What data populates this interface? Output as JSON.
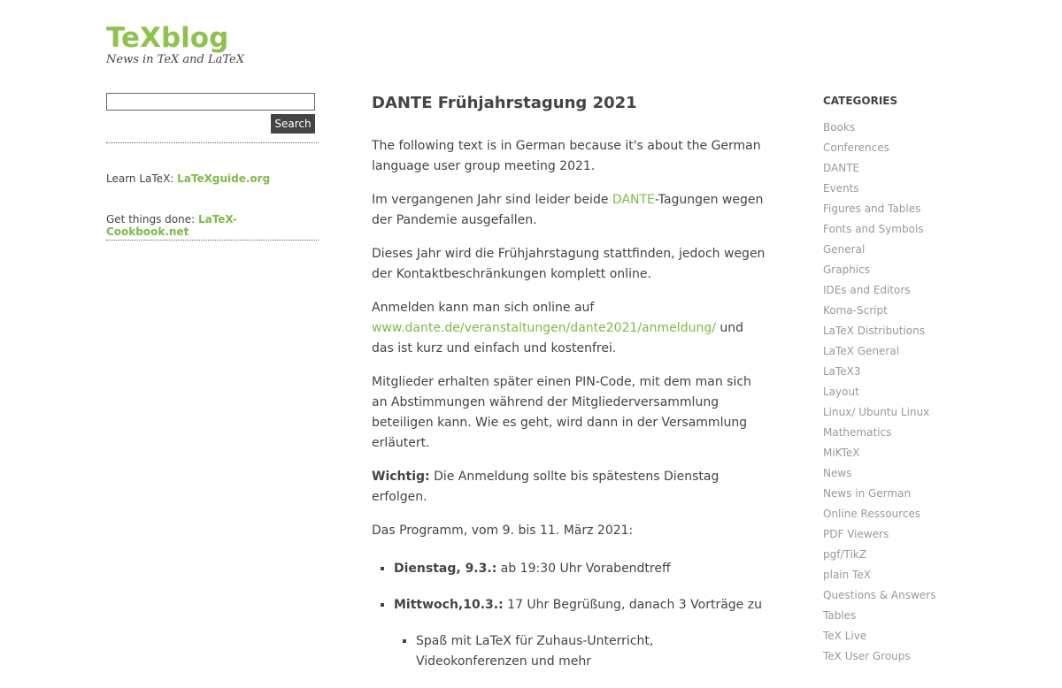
{
  "header": {
    "site_title": "TeXblog",
    "tagline": "News in TeX and LaTeX"
  },
  "search": {
    "button_label": "Search",
    "value": ""
  },
  "left_widgets": [
    {
      "prefix": "Learn LaTeX:",
      "link": "LaTeXguide.org"
    },
    {
      "prefix": "Get things done:",
      "link": "LaTeX-Cookbook.net"
    }
  ],
  "post": {
    "title": "DANTE Frühjahrstagung 2021",
    "p1": "The following text is in German because it's about the German language user group meeting 2021.",
    "p2_before": "Im vergangenen Jahr sind leider beide ",
    "p2_link": "DANTE",
    "p2_after": "-Tagungen wegen der Pandemie ausgefallen.",
    "p3": "Dieses Jahr wird die Frühjahrstagung stattfinden, jedoch wegen der Kontaktbeschränkungen komplett online.",
    "p4_before": "Anmelden kann man sich online auf ",
    "p4_link": "www.dante.de/veranstaltungen/dante2021/anmeldung/",
    "p4_after": " und das ist kurz und einfach und kostenfrei.",
    "p5": "Mitglieder erhalten später einen PIN-Code, mit dem man sich an Abstimmungen während der Mitgliederversammlung beteiligen kann. Wie es geht, wird dann in der Versammlung erläutert.",
    "p6_bold": "Wichtig:",
    "p6_text": " Die Anmeldung sollte bis spätestens Dienstag erfolgen.",
    "p7": "Das Programm, vom 9. bis 11. März 2021:",
    "program": [
      {
        "bold": "Dienstag, 9.3.:",
        "text": " ab 19:30 Uhr Vorabendtreff"
      },
      {
        "bold": "Mittwoch,10.3.:",
        "text": " 17 Uhr Begrüßung, danach 3 Vorträge zu"
      }
    ],
    "sub_item": "Spaß mit LaTeX für Zuhaus-Unterricht, Videokonferenzen und mehr"
  },
  "categories": {
    "heading": "CATEGORIES",
    "items": [
      "Books",
      "Conferences",
      "DANTE",
      "Events",
      "Figures and Tables",
      "Fonts and Symbols",
      "General",
      "Graphics",
      "IDEs and Editors",
      "Koma-Script",
      "LaTeX Distributions",
      "LaTeX General",
      "LaTeX3",
      "Layout",
      "Linux/ Ubuntu Linux",
      "Mathematics",
      "MiKTeX",
      "News",
      "News in German",
      "Online Ressources",
      "PDF Viewers",
      "pgf/TikZ",
      "plain TeX",
      "Questions & Answers",
      "Tables",
      "TeX Live",
      "TeX User Groups"
    ]
  },
  "colors": {
    "brand_green": "#8dc34a",
    "link_green": "#7cbb45",
    "text": "#444444",
    "category_gray": "#999999",
    "search_button_bg": "#444444"
  }
}
